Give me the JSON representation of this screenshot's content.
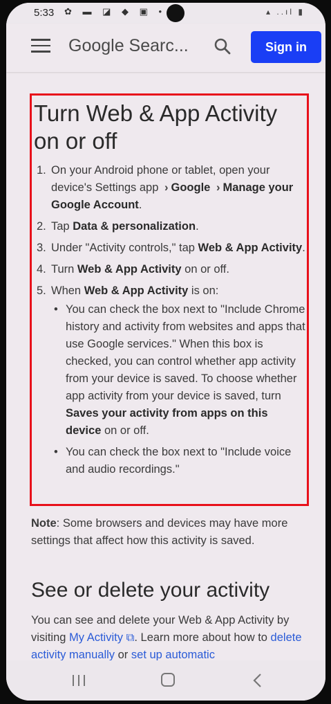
{
  "status_bar": {
    "time": "5:33",
    "icons": "✿ ▬ ◪ ◆ ▣ •",
    "right": "▴ ..ıl ▮"
  },
  "app_bar": {
    "title": "Google Searc...",
    "sign_in_label": "Sign in",
    "sign_in_color": "#1a3ef5"
  },
  "article": {
    "heading": "Turn Web & App Activity on or off",
    "steps": [
      {
        "num": "1.",
        "text_a": "On your Android phone or tablet, open your device's Settings app",
        "chev": "›",
        "b1": "Google",
        "b2": "Manage your Google Account",
        "tail": "."
      },
      {
        "num": "2.",
        "text": "Tap ",
        "bold": "Data & personalization",
        "tail": "."
      },
      {
        "num": "3.",
        "text": "Under \"Activity controls,\" tap ",
        "bold": "Web & App Activity",
        "tail": "."
      },
      {
        "num": "4.",
        "text": "Turn ",
        "bold": "Web & App Activity",
        "tail": " on or off."
      },
      {
        "num": "5.",
        "text": "When ",
        "bold": "Web & App Activity",
        "tail": " is on:"
      }
    ],
    "bullets": [
      {
        "text": "You can check the box next to \"Include Chrome history and activity from websites and apps that use Google services.\" When this box is checked, you can control whether app activity from your device is saved. To choose whether app activity from your device is saved, turn ",
        "bold": "Saves your activity from apps on this device",
        "tail": " on or off."
      },
      {
        "text": "You can check the box next to \"Include voice and audio recordings.\""
      }
    ],
    "bullet_char": "•",
    "note_label": "Note",
    "note_text": ": Some browsers and devices may have more settings that affect how this activity is saved.",
    "heading2": "See or delete your activity",
    "para_a": "You can see and delete your Web & App Activity by visiting ",
    "link1": "My Activity",
    "link1_icon": "⧉",
    "para_b": ". Learn more about how to ",
    "link2": "delete activity manually",
    "para_c": " or ",
    "link3": "set up automatic"
  },
  "nav_bar": {
    "recents": "recents-icon",
    "home": "home-icon",
    "back": "back-icon"
  },
  "colors": {
    "accent": "#1a3ef5",
    "highlight": "#e8101a",
    "link": "#2a5bd7"
  }
}
